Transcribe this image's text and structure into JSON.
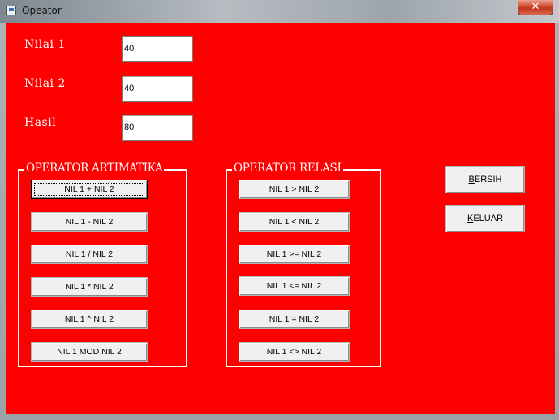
{
  "window": {
    "title": "Opeator",
    "close_glyph": "✕"
  },
  "form": {
    "nilai1": {
      "label": "Nilai 1",
      "value": "40"
    },
    "nilai2": {
      "label": "Nilai 2",
      "value": "40"
    },
    "hasil": {
      "label": "Hasil",
      "value": "80"
    }
  },
  "arith": {
    "title": "OPERATOR ARTIMATIKA",
    "buttons": [
      "NIL 1 + NIL 2",
      "NIL 1 - NIL 2",
      "NIL 1 / NIL 2",
      "NIL 1 * NIL 2",
      "NIL 1 ^ NIL 2",
      "NIL 1 MOD NIL 2"
    ]
  },
  "rel": {
    "title": "OPERATOR RELASI",
    "buttons": [
      "NIL 1 > NIL 2",
      "NIL 1 < NIL 2",
      "NIL 1 >= NIL 2",
      "NIL 1 <= NIL 2",
      "NIL 1 = NIL 2",
      "NIL 1 <> NIL 2"
    ]
  },
  "actions": {
    "bersih": {
      "first": "B",
      "rest": "ERSIH"
    },
    "keluar": {
      "first": "K",
      "rest": "ELUAR"
    }
  },
  "colors": {
    "form_background": "#ff0000",
    "label_text": "#ffffff"
  }
}
